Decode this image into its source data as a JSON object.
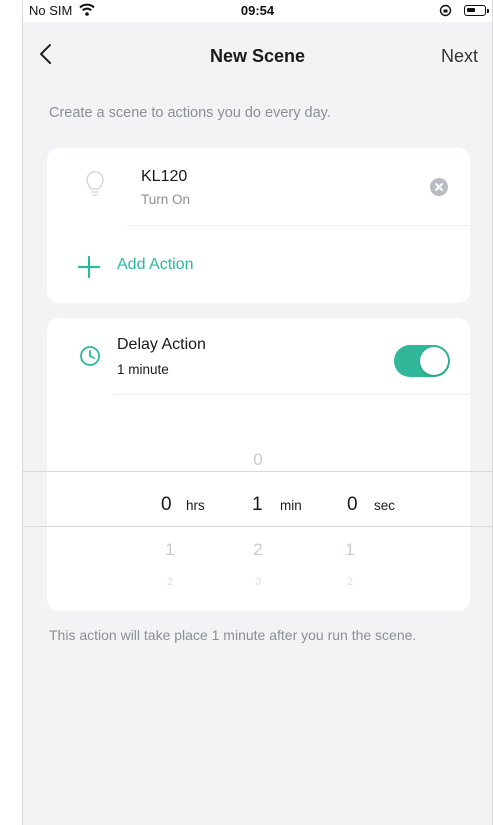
{
  "status_bar": {
    "carrier": "No SIM",
    "time": "09:54"
  },
  "nav": {
    "title": "New Scene",
    "next_label": "Next"
  },
  "description": "Create a scene to actions you do every day.",
  "actions_card": {
    "device_name": "KL120",
    "device_action": "Turn On",
    "add_action_label": "Add Action"
  },
  "delay_card": {
    "title": "Delay Action",
    "value": "1 minute",
    "toggle_on": true,
    "picker": {
      "hrs": {
        "above": "",
        "selected": "0",
        "below": "1",
        "below2": "2",
        "unit": "hrs"
      },
      "min": {
        "above": "0",
        "selected": "1",
        "below": "2",
        "below2": "3",
        "unit": "min"
      },
      "sec": {
        "above": "",
        "selected": "0",
        "below": "1",
        "below2": "2",
        "unit": "sec"
      }
    }
  },
  "footer_note": "This action will take place 1 minute after you run the scene.",
  "colors": {
    "accent": "#28b9a1",
    "toggle": "#30b79a",
    "background": "#f2f3f5"
  }
}
